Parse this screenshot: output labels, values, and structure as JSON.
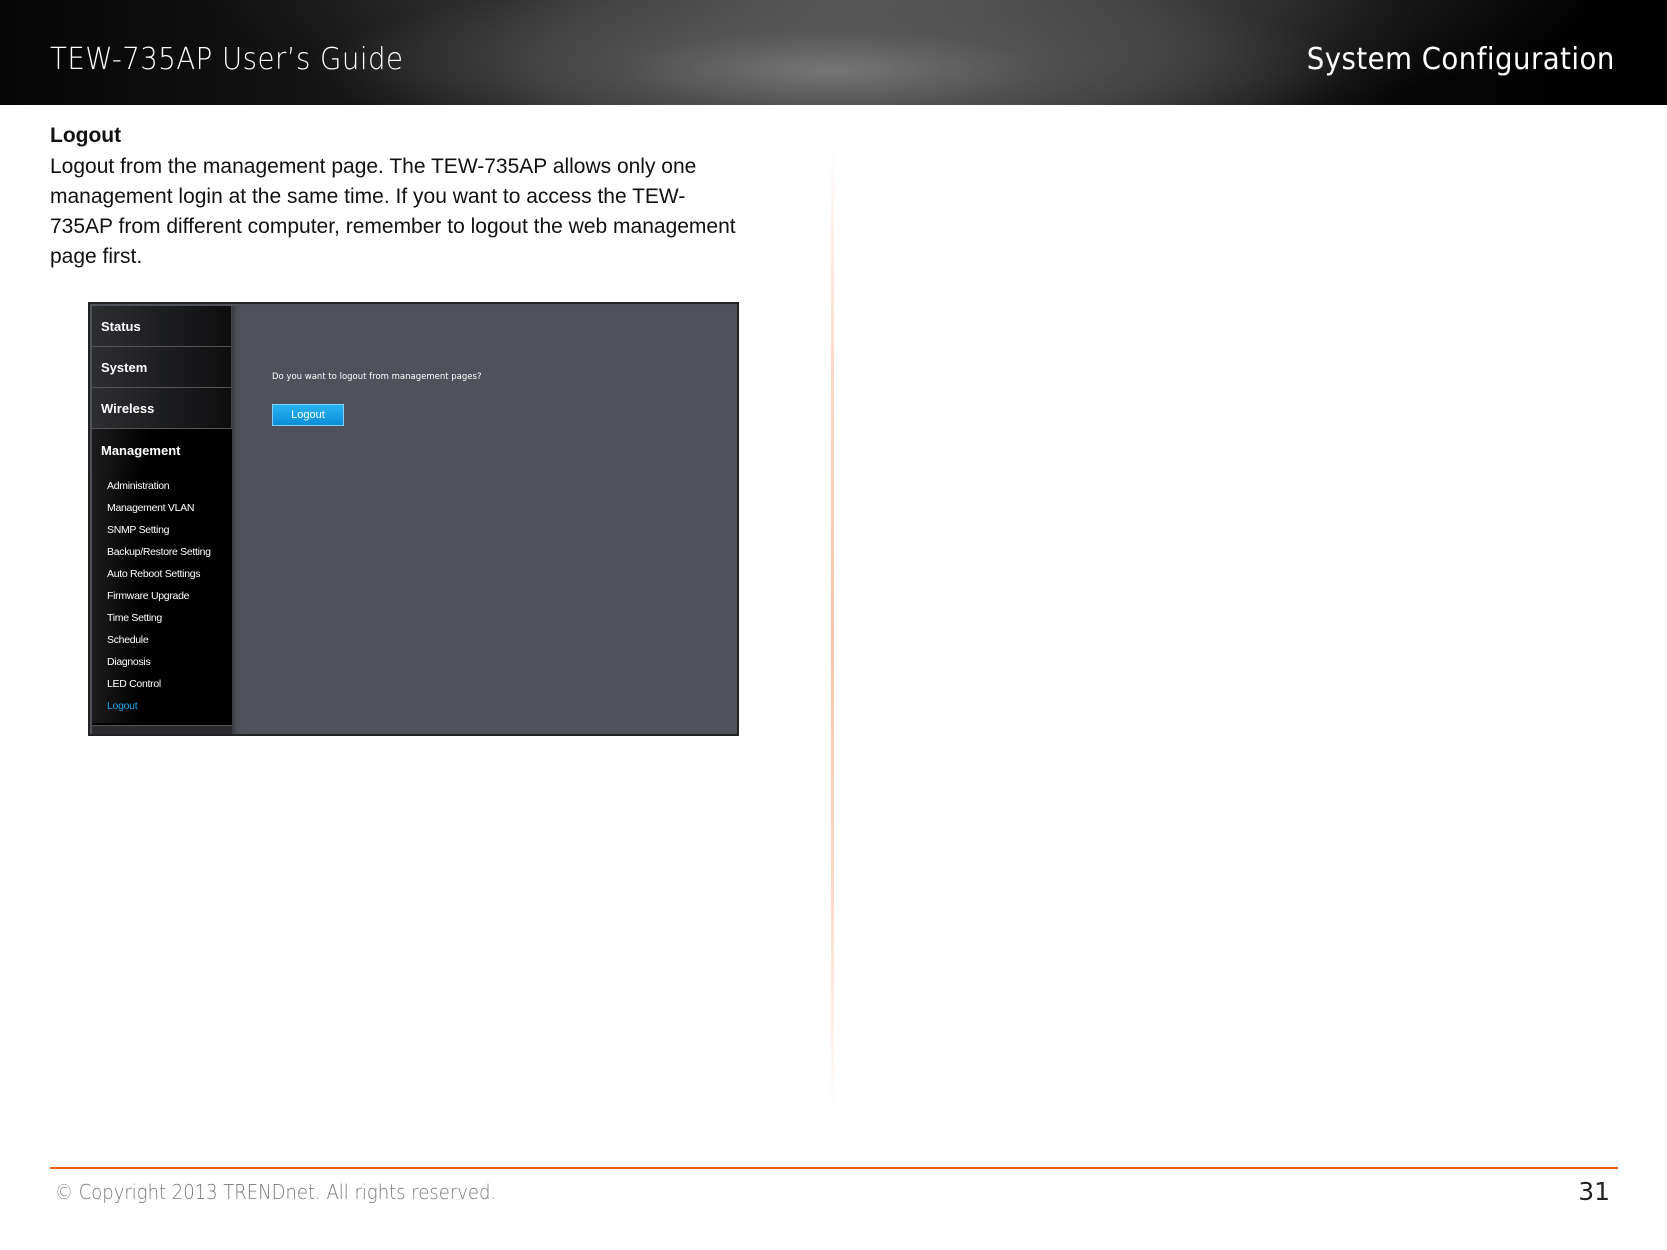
{
  "header": {
    "title": "TEW-735AP User’s Guide",
    "section": "System Configuration"
  },
  "content": {
    "heading": "Logout",
    "body": "Logout from the management page. The TEW-735AP allows only one management login at the same time. If you want to access the TEW-735AP from different computer, remember to logout the web management page first."
  },
  "screenshot": {
    "nav_main": [
      {
        "label": "Status",
        "active": false
      },
      {
        "label": "System",
        "active": false
      },
      {
        "label": "Wireless",
        "active": false
      },
      {
        "label": "Management",
        "active": true
      }
    ],
    "sub_items": [
      {
        "label": "Administration",
        "active": false
      },
      {
        "label": "Management VLAN",
        "active": false
      },
      {
        "label": "SNMP Setting",
        "active": false
      },
      {
        "label": "Backup/Restore Setting",
        "active": false
      },
      {
        "label": "Auto Reboot Settings",
        "active": false
      },
      {
        "label": "Firmware Upgrade",
        "active": false
      },
      {
        "label": "Time Setting",
        "active": false
      },
      {
        "label": "Schedule",
        "active": false
      },
      {
        "label": "Diagnosis",
        "active": false
      },
      {
        "label": "LED Control",
        "active": false
      },
      {
        "label": "Logout",
        "active": true
      }
    ],
    "question": "Do you want to logout from management pages?",
    "logout_button": "Logout",
    "colors": {
      "active_link": "#1aa3e8",
      "button": "#0b8fd8",
      "panel": "#4f525a"
    }
  },
  "footer": {
    "copyright": "© Copyright 2013 TRENDnet. All rights reserved.",
    "page_number": "31",
    "rule_color": "#e8600f"
  }
}
